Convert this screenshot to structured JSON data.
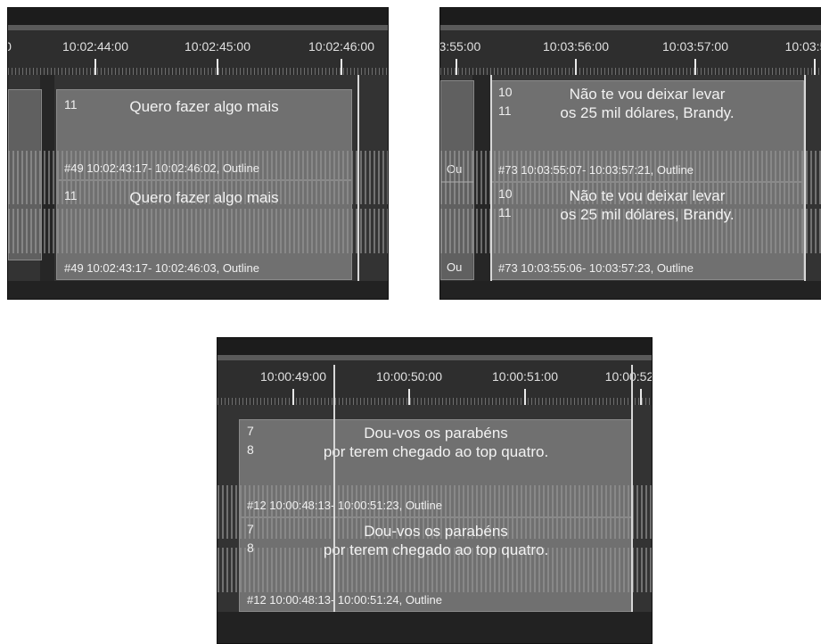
{
  "panels": [
    {
      "timecodes": [
        "0",
        "10:02:44:00",
        "10:02:45:00",
        "10:02:46:00"
      ],
      "top_block": {
        "lines": [
          "11"
        ],
        "text": [
          "Quero fazer algo mais"
        ],
        "info": "#49 10:02:43:17- 10:02:46:02, Outline"
      },
      "bottom_block": {
        "lines": [
          "11"
        ],
        "text": [
          "Quero fazer algo mais"
        ],
        "info": "#49 10:02:43:17- 10:02:46:03, Outline"
      }
    },
    {
      "timecodes": [
        "03:55:00",
        "10:03:56:00",
        "10:03:57:00",
        "10:03:5"
      ],
      "top_block": {
        "lines": [
          "10",
          "11"
        ],
        "text": [
          "Não te vou deixar levar",
          "os 25 mil dólares, Brandy."
        ],
        "info": "#73 10:03:55:07- 10:03:57:21, Outline"
      },
      "bottom_block": {
        "lines": [
          "10",
          "11"
        ],
        "text": [
          "Não te vou deixar levar",
          "os 25 mil dólares, Brandy."
        ],
        "info": "#73 10:03:55:06- 10:03:57:23, Outline"
      },
      "side_label_top": "Ou",
      "side_label_bottom": "Ou"
    },
    {
      "timecodes": [
        "10:00:49:00",
        "10:00:50:00",
        "10:00:51:00",
        "10:00:52"
      ],
      "top_block": {
        "lines": [
          "7",
          "8"
        ],
        "text": [
          "Dou-vos os parabéns",
          "por terem chegado ao top quatro."
        ],
        "info": "#12 10:00:48:13- 10:00:51:23, Outline"
      },
      "bottom_block": {
        "lines": [
          "7",
          "8"
        ],
        "text": [
          "Dou-vos os parabéns",
          "por terem chegado ao top quatro."
        ],
        "info": "#12 10:00:48:13- 10:00:51:24, Outline"
      }
    }
  ]
}
